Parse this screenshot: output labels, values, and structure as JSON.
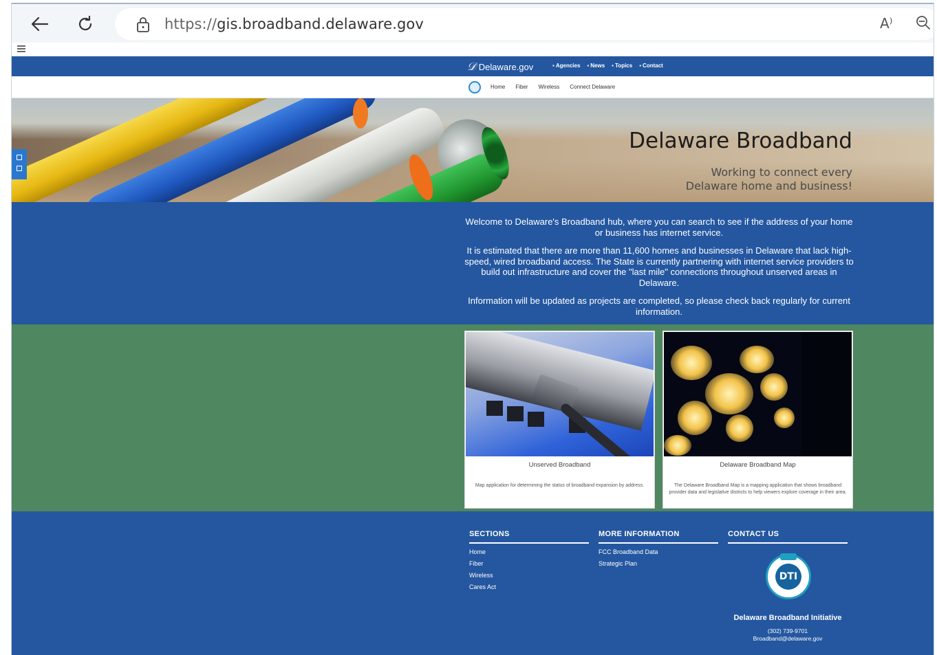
{
  "browser": {
    "url_protocol": "https://",
    "url_host": "gis.broadband.delaware.gov",
    "read_aloud_label": "A⁾"
  },
  "gov_bar": {
    "logo_text": "Delaware.gov",
    "links": [
      "Agencies",
      "News",
      "Topics",
      "Contact"
    ]
  },
  "site_nav": {
    "links": [
      "Home",
      "Fiber",
      "Wireless",
      "Connect Delaware"
    ]
  },
  "hero": {
    "title": "Delaware Broadband",
    "subtitle_line1": "Working to connect every",
    "subtitle_line2": "Delaware home and business!"
  },
  "intro": {
    "p1": "Welcome to Delaware's Broadband hub, where you can search to see if the address of your home or business has internet service.",
    "p2": "It is estimated that there are more than 11,600 homes and businesses in Delaware that lack high-speed, wired broadband access. The State is currently partnering with internet service providers to build out infrastructure and cover the \"last mile\" connections throughout unserved areas in Delaware.",
    "p3": "Information will be updated as projects are completed, so please check back regularly for current information."
  },
  "cards": [
    {
      "title": "Unserved Broadband",
      "description": "Map application for determining the status of broadband expansion by address."
    },
    {
      "title": "Delaware Broadband Map",
      "description": "The Delaware Broadband Map is a mapping application that shows broadband provider data and legislative districts to help viewers explore coverage in their area."
    }
  ],
  "footer": {
    "sections_heading": "SECTIONS",
    "sections": [
      "Home",
      "Fiber",
      "Wireless",
      "Cares Act"
    ],
    "more_heading": "MORE INFORMATION",
    "more": [
      "FCC Broadband Data",
      "Strategic Plan"
    ],
    "contact_heading": "CONTACT US",
    "logo_text": "DTI",
    "org_name": "Delaware Broadband Initiative",
    "phone": "(302) 739-9701",
    "email": "Broadband@delaware.gov"
  },
  "colors": {
    "primary_blue": "#2457a0",
    "band_green": "#4f8760"
  }
}
